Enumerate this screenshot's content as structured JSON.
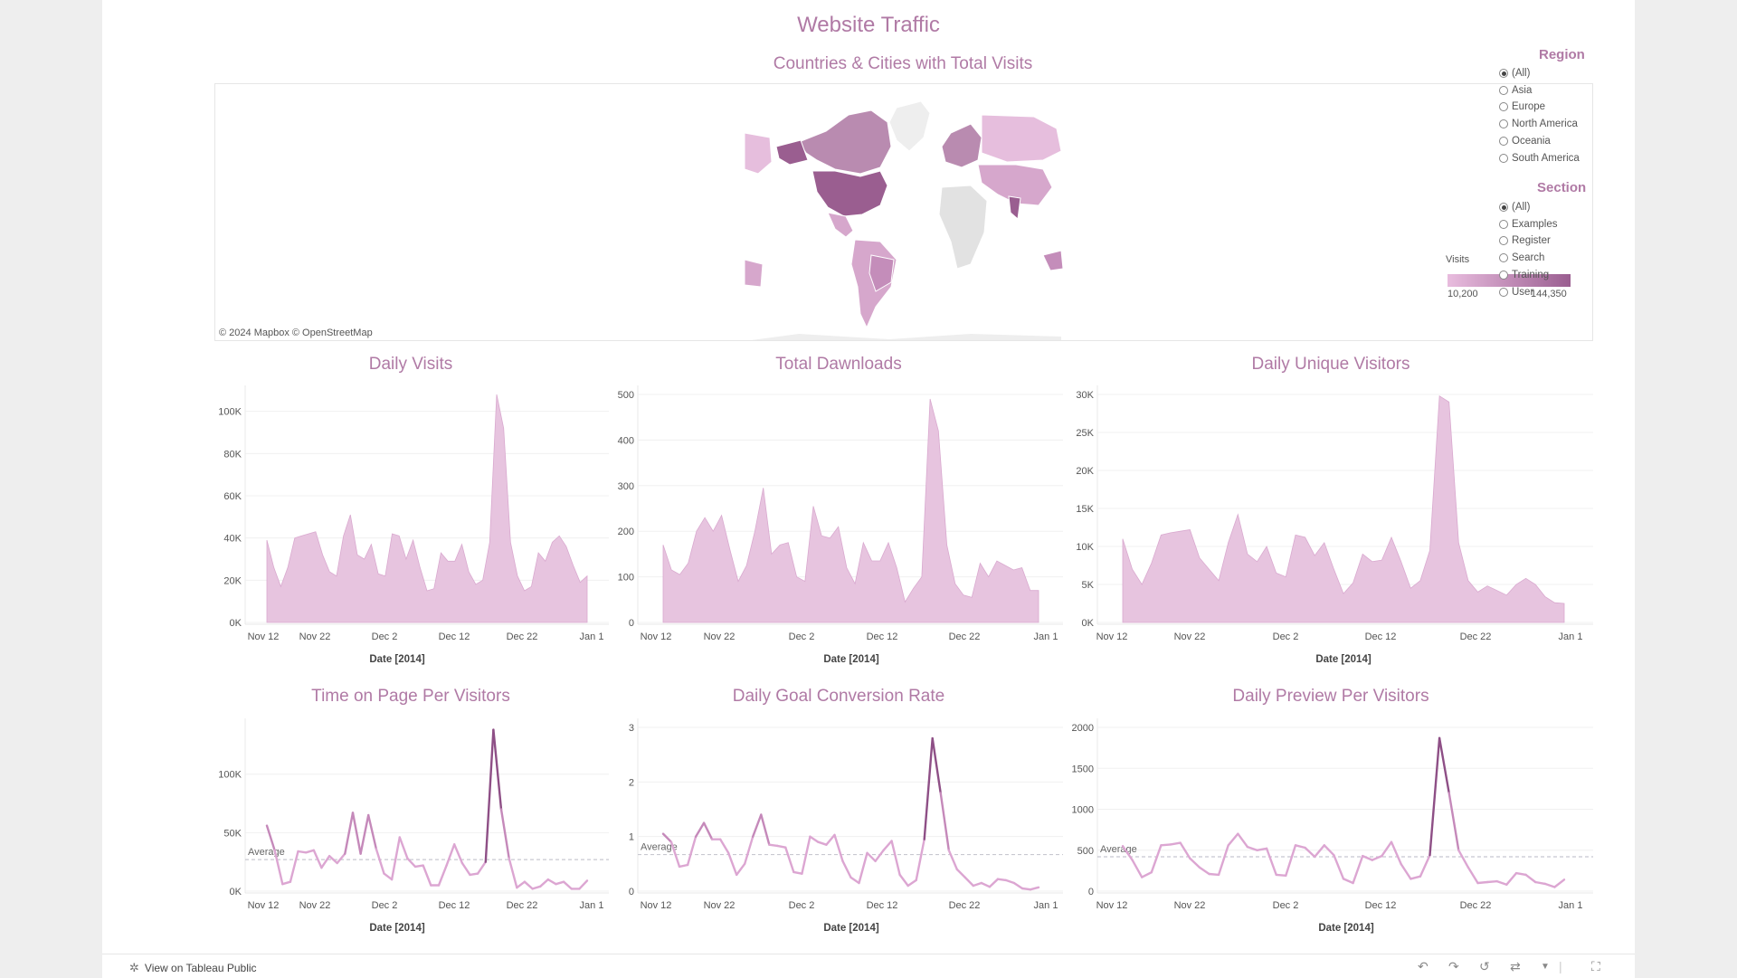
{
  "dashboard": {
    "title": "Website Traffic",
    "map_title": "Countries & Cities with Total Visits",
    "map_credit": "© 2024 Mapbox  © OpenStreetMap",
    "legend": {
      "title": "Visits",
      "min": "10,200",
      "max": "144,350"
    }
  },
  "filters": {
    "region": {
      "title": "Region",
      "options": [
        "(All)",
        "Asia",
        "Europe",
        "North America",
        "Oceania",
        "South America"
      ],
      "selected": "(All)"
    },
    "section": {
      "title": "Section",
      "options": [
        "(All)",
        "Examples",
        "Register",
        "Search",
        "Training",
        "User"
      ],
      "selected": "(All)"
    }
  },
  "footer": {
    "link": "View on Tableau Public"
  },
  "colors": {
    "accent": "#b07aa5",
    "area_fill": "#e7c4df",
    "line_light": "#dca6d2",
    "line_dark": "#8e4f86"
  },
  "chart_data": [
    {
      "id": "daily-visits",
      "type": "area",
      "title": "Daily Visits",
      "xlabel": "Date [2014]",
      "yticks": [
        "0K",
        "20K",
        "40K",
        "60K",
        "80K",
        "100K"
      ],
      "ylim": [
        0,
        108000
      ],
      "xticks": [
        "Nov 12",
        "Nov 22",
        "Dec 2",
        "Dec 12",
        "Dec 22",
        "Jan 1"
      ],
      "values": [
        39000,
        26000,
        17000,
        26000,
        40000,
        41000,
        42000,
        43000,
        32000,
        24000,
        22000,
        41000,
        51000,
        32000,
        30000,
        37000,
        23000,
        22000,
        42000,
        41000,
        30000,
        39000,
        26000,
        15000,
        16000,
        33000,
        29000,
        29000,
        37000,
        24000,
        18000,
        20000,
        38000,
        108000,
        92000,
        38000,
        22000,
        15000,
        17000,
        33000,
        29000,
        38000,
        41000,
        36000,
        27000,
        19000,
        22000
      ]
    },
    {
      "id": "total-downloads",
      "type": "area",
      "title": "Total Dawnloads",
      "xlabel": "Date [2014]",
      "yticks": [
        "0",
        "100",
        "200",
        "300",
        "400",
        "500"
      ],
      "ylim": [
        0,
        500
      ],
      "xticks": [
        "Nov 12",
        "Nov 22",
        "Dec 2",
        "Dec 12",
        "Dec 22",
        "Jan 1"
      ],
      "values": [
        170,
        115,
        105,
        130,
        200,
        230,
        200,
        235,
        160,
        90,
        125,
        200,
        295,
        150,
        170,
        175,
        100,
        90,
        255,
        190,
        185,
        210,
        120,
        85,
        175,
        135,
        135,
        175,
        120,
        45,
        75,
        100,
        490,
        420,
        170,
        85,
        60,
        55,
        130,
        100,
        135,
        125,
        115,
        120,
        70,
        70
      ]
    },
    {
      "id": "daily-unique-visitors",
      "type": "area",
      "title": "Daily Unique Visitors",
      "xlabel": "Date [2014]",
      "yticks": [
        "0K",
        "5K",
        "10K",
        "15K",
        "20K",
        "25K",
        "30K"
      ],
      "ylim": [
        0,
        30000
      ],
      "xticks": [
        "Nov 12",
        "Nov 22",
        "Dec 2",
        "Dec 12",
        "Dec 22",
        "Jan 1"
      ],
      "values": [
        11000,
        7000,
        5000,
        7800,
        11500,
        11800,
        12000,
        12200,
        8500,
        7000,
        5500,
        10500,
        14200,
        9000,
        8000,
        10000,
        6500,
        6000,
        11500,
        11200,
        8800,
        10500,
        7000,
        3800,
        5200,
        9000,
        8000,
        8200,
        11200,
        8000,
        4500,
        5500,
        9500,
        29800,
        29000,
        10500,
        5500,
        4000,
        4800,
        4200,
        3600,
        5000,
        5800,
        5000,
        3400,
        2600,
        2500
      ]
    },
    {
      "id": "time-on-page",
      "type": "line",
      "title": "Time on Page Per Visitors",
      "xlabel": "Date [2014]",
      "yticks": [
        "0K",
        "50K",
        "100K"
      ],
      "ylim": [
        0,
        140000
      ],
      "xticks": [
        "Nov 12",
        "Nov 22",
        "Dec 2",
        "Dec 12",
        "Dec 22",
        "Jan 1"
      ],
      "average_label": "Average",
      "average": 27000,
      "values": [
        56000,
        35000,
        6000,
        8000,
        34000,
        33000,
        35000,
        20000,
        30000,
        24000,
        32000,
        67000,
        32000,
        65000,
        36000,
        15000,
        10000,
        46000,
        28000,
        21000,
        22000,
        5000,
        5000,
        22000,
        40000,
        24000,
        14000,
        15000,
        25000,
        138000,
        70000,
        28000,
        3000,
        8000,
        2000,
        4000,
        10000,
        6000,
        8000,
        2000,
        2000,
        9000
      ]
    },
    {
      "id": "goal-conversion",
      "type": "line",
      "title": "Daily Goal Conversion Rate",
      "xlabel": "Date [2014]",
      "yticks": [
        "0",
        "1",
        "2",
        "3"
      ],
      "ylim": [
        0,
        3
      ],
      "xticks": [
        "Nov 12",
        "Nov 22",
        "Dec 2",
        "Dec 12",
        "Dec 22",
        "Jan 1"
      ],
      "average_label": "Average",
      "average": 0.67,
      "values": [
        1.05,
        0.9,
        0.45,
        0.48,
        1.0,
        1.25,
        0.95,
        0.95,
        0.7,
        0.3,
        0.5,
        1.0,
        1.4,
        0.85,
        0.83,
        0.8,
        0.35,
        0.32,
        1.0,
        0.9,
        0.85,
        1.03,
        0.55,
        0.25,
        0.15,
        0.7,
        0.55,
        0.75,
        0.92,
        0.3,
        0.1,
        0.2,
        0.95,
        2.8,
        1.8,
        0.75,
        0.4,
        0.25,
        0.1,
        0.15,
        0.08,
        0.22,
        0.2,
        0.15,
        0.05,
        0.03,
        0.07
      ]
    },
    {
      "id": "preview-per-visitors",
      "type": "line",
      "title": "Daily Preview Per Visitors",
      "xlabel": "Date [2014]",
      "yticks": [
        "0",
        "500",
        "1000",
        "1500",
        "2000"
      ],
      "ylim": [
        0,
        2000
      ],
      "xticks": [
        "Nov 12",
        "Nov 22",
        "Dec 2",
        "Dec 12",
        "Dec 22",
        "Jan 1"
      ],
      "average_label": "Average",
      "average": 420,
      "values": [
        550,
        380,
        170,
        230,
        560,
        570,
        590,
        400,
        290,
        210,
        200,
        560,
        700,
        540,
        500,
        520,
        200,
        190,
        560,
        530,
        420,
        560,
        440,
        150,
        100,
        430,
        380,
        430,
        600,
        330,
        150,
        180,
        440,
        1870,
        1200,
        500,
        290,
        100,
        110,
        120,
        80,
        220,
        200,
        110,
        90,
        50,
        140
      ]
    }
  ]
}
